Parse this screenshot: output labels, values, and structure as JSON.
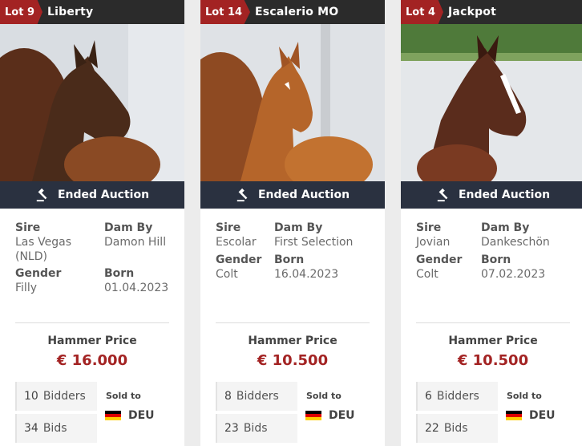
{
  "common": {
    "ended_label": "Ended Auction",
    "sire_label": "Sire",
    "dam_label": "Dam By",
    "gender_label": "Gender",
    "born_label": "Born",
    "hammer_label": "Hammer Price",
    "bidders_label": "Bidders",
    "bids_label": "Bids",
    "sold_to_label": "Sold to"
  },
  "colors": {
    "lot_badge": "#a32323",
    "header_bg": "#2b2b2b",
    "auction_bar": "#2a3140",
    "price": "#a32323"
  },
  "cards": [
    {
      "lot": "Lot 9",
      "name": "Liberty",
      "sire": "Las Vegas (NLD)",
      "dam": "Damon Hill",
      "gender": "Filly",
      "born": "01.04.2023",
      "price": "€ 16.000",
      "bidders": "10",
      "bids": "34",
      "country": "DEU",
      "coat": "#4a2b1a",
      "icon": "gavel-icon"
    },
    {
      "lot": "Lot 14",
      "name": "Escalerio MO",
      "sire": "Escolar",
      "dam": "First Selection",
      "gender": "Colt",
      "born": "16.04.2023",
      "price": "€ 10.500",
      "bidders": "8",
      "bids": "23",
      "country": "DEU",
      "coat": "#b5652a",
      "icon": "gavel-icon"
    },
    {
      "lot": "Lot 4",
      "name": "Jackpot",
      "sire": "Jovian",
      "dam": "Dankeschön",
      "gender": "Colt",
      "born": "07.02.2023",
      "price": "€ 10.500",
      "bidders": "6",
      "bids": "22",
      "country": "DEU",
      "coat": "#5a2c1c",
      "icon": "gavel-icon"
    }
  ]
}
